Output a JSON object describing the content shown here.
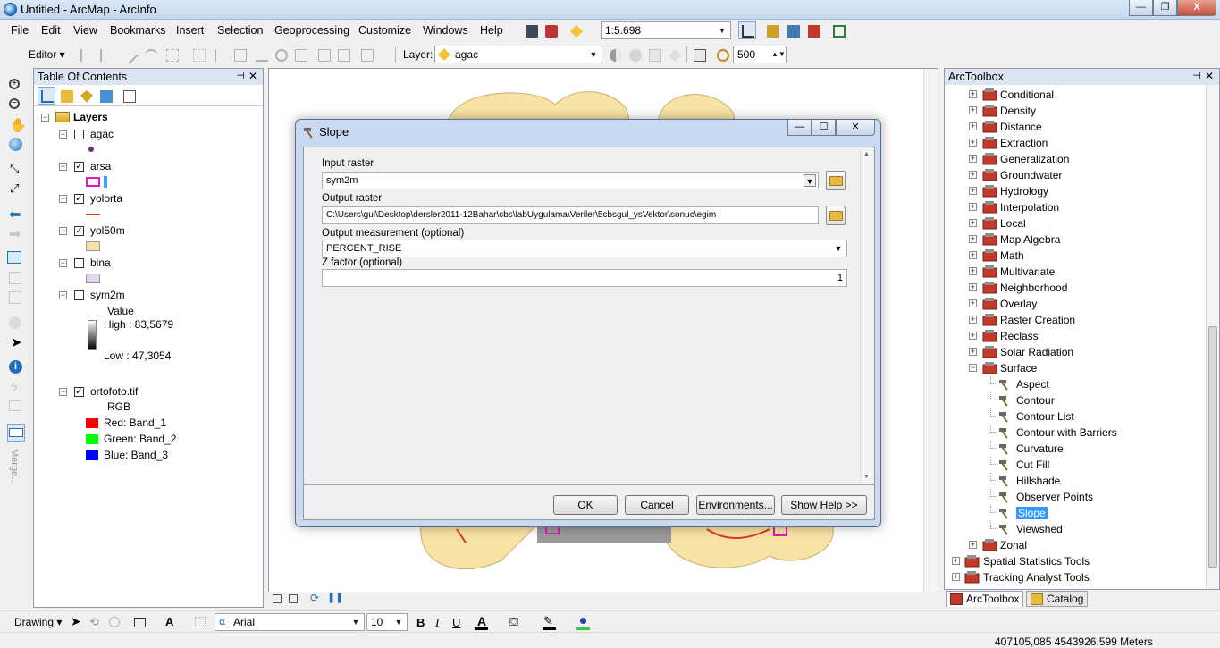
{
  "window": {
    "title": "Untitled - ArcMap - ArcInfo",
    "minimize": "—",
    "maximize": "❐",
    "close": "X"
  },
  "menu": [
    "File",
    "Edit",
    "View",
    "Bookmarks",
    "Insert",
    "Selection",
    "Geoprocessing",
    "Customize",
    "Windows",
    "Help"
  ],
  "scale": {
    "value": "1:5.698"
  },
  "editor": {
    "label": "Editor ▾"
  },
  "layer_combo": {
    "label": "Layer:",
    "value": "agac"
  },
  "resolution": {
    "value": "500"
  },
  "toc": {
    "title": "Table Of Contents",
    "layers_label": "Layers",
    "layers": [
      {
        "name": "agac",
        "checked": false
      },
      {
        "name": "arsa",
        "checked": true
      },
      {
        "name": "yolorta",
        "checked": true
      },
      {
        "name": "yol50m",
        "checked": true
      },
      {
        "name": "bina",
        "checked": false
      },
      {
        "name": "sym2m",
        "checked": false
      },
      {
        "name": "ortofoto.tif",
        "checked": true
      }
    ],
    "sym2m_legend": {
      "value_label": "Value",
      "high": "High : 83,5679",
      "low": "Low : 47,3054"
    },
    "ortofoto_legend": {
      "rgb": "RGB",
      "red": "Red:   Band_1",
      "green": "Green: Band_2",
      "blue": "Blue:  Band_3"
    }
  },
  "dialog": {
    "title": "Slope",
    "input_raster_label": "Input raster",
    "input_raster_value": "sym2m",
    "output_raster_label": "Output raster",
    "output_raster_value": "C:\\Users\\gul\\Desktop\\dersler2011-12Bahar\\cbs\\labUygulama\\Veriler\\5cbsgul_ysVektor\\sonuc\\egim",
    "measurement_label": "Output measurement (optional)",
    "measurement_value": "PERCENT_RISE",
    "zfactor_label": "Z factor (optional)",
    "zfactor_value": "1",
    "ok": "OK",
    "cancel": "Cancel",
    "environments": "Environments...",
    "show_help": "Show Help >>"
  },
  "arctoolbox": {
    "title": "ArcToolbox",
    "toolsets": [
      "Conditional",
      "Density",
      "Distance",
      "Extraction",
      "Generalization",
      "Groundwater",
      "Hydrology",
      "Interpolation",
      "Local",
      "Map Algebra",
      "Math",
      "Multivariate",
      "Neighborhood",
      "Overlay",
      "Raster Creation",
      "Reclass",
      "Solar Radiation",
      "Surface"
    ],
    "surface_tools": [
      "Aspect",
      "Contour",
      "Contour List",
      "Contour with Barriers",
      "Curvature",
      "Cut Fill",
      "Hillshade",
      "Observer Points",
      "Slope",
      "Viewshed"
    ],
    "after": [
      "Zonal"
    ],
    "top_level": [
      "Spatial Statistics Tools",
      "Tracking Analyst Tools"
    ],
    "selected": "Slope"
  },
  "bottom_tabs": {
    "arctoolbox": "ArcToolbox",
    "catalog": "Catalog"
  },
  "drawing": {
    "label": "Drawing ▾",
    "font": "Arial",
    "size": "10",
    "bold": "B",
    "italic": "I",
    "underline": "U",
    "font_color": "A"
  },
  "lefttools_merge": "Merge...",
  "status": {
    "coords": "407105,085  4543926,599 Meters"
  }
}
